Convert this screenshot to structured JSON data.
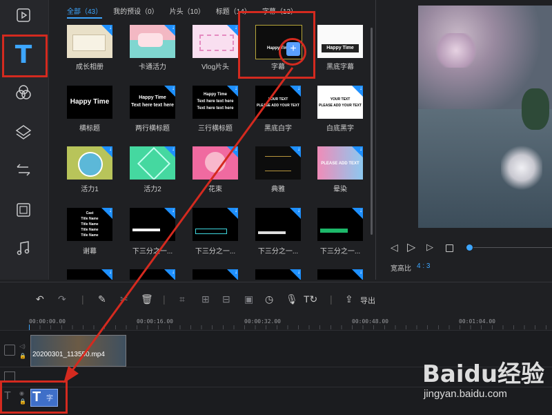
{
  "sidebar": {
    "items": [
      {
        "icon": "media-icon"
      },
      {
        "icon": "text-icon",
        "glyph": "T"
      },
      {
        "icon": "filter-icon"
      },
      {
        "icon": "overlay-icon"
      },
      {
        "icon": "transition-icon"
      },
      {
        "icon": "film-icon"
      },
      {
        "icon": "music-icon"
      }
    ]
  },
  "tabs": [
    {
      "label": "全部（43）",
      "active": true
    },
    {
      "label": "我的预设（0）"
    },
    {
      "label": "片头（10）"
    },
    {
      "label": "标题（14）"
    },
    {
      "label": "字幕（13）"
    }
  ],
  "templates": [
    {
      "caption": "成长相册"
    },
    {
      "caption": "卡通活力"
    },
    {
      "caption": "Vlog片头"
    },
    {
      "caption": "字幕",
      "thumb_text": "Happy Time"
    },
    {
      "caption": "黑底字幕",
      "thumb_text": "Happy Time"
    },
    {
      "caption": "横标题",
      "thumb_text": "Happy Time"
    },
    {
      "caption": "两行横标题",
      "thumb_text": "Happy Time\nText here text here"
    },
    {
      "caption": "三行横标题",
      "thumb_text": "Happy Time\nText here text here\nText here text here"
    },
    {
      "caption": "黑底白字",
      "thumb_text": "YOUR TEXT\nPLEASE ADD YOUR TEXT"
    },
    {
      "caption": "白底黑字",
      "thumb_text": "YOUR TEXT\nPLEASE ADD YOUR TEXT"
    },
    {
      "caption": "活力1"
    },
    {
      "caption": "活力2"
    },
    {
      "caption": "花束"
    },
    {
      "caption": "典雅"
    },
    {
      "caption": "晕染",
      "thumb_text": "PLEASE ADD TEXT"
    },
    {
      "caption": "谢幕",
      "thumb_text": "Cast\nTitle Name\nTitle Name\nTitle Name\nTitle Name"
    },
    {
      "caption": "下三分之一..."
    },
    {
      "caption": "下三分之一..."
    },
    {
      "caption": "下三分之一..."
    },
    {
      "caption": "下三分之一..."
    }
  ],
  "preview": {
    "aspect_label": "宽高比",
    "aspect_value": "4 : 3"
  },
  "toolbar": {
    "export_label": "导出"
  },
  "timeline": {
    "ticks": [
      "00:00:00.00",
      "00:00:16.00",
      "00:00:32.00",
      "00:00:48.00",
      "00:01:04.00"
    ],
    "clip_name": "20200301_113550.mp4",
    "text_clip_glyph": "T",
    "text_clip_label": "字"
  },
  "watermark": {
    "brand": "Baidu经验",
    "url": "jingyan.baidu.com"
  },
  "colors": {
    "accent": "#3da6ff",
    "highlight_red": "#d42a1f"
  }
}
